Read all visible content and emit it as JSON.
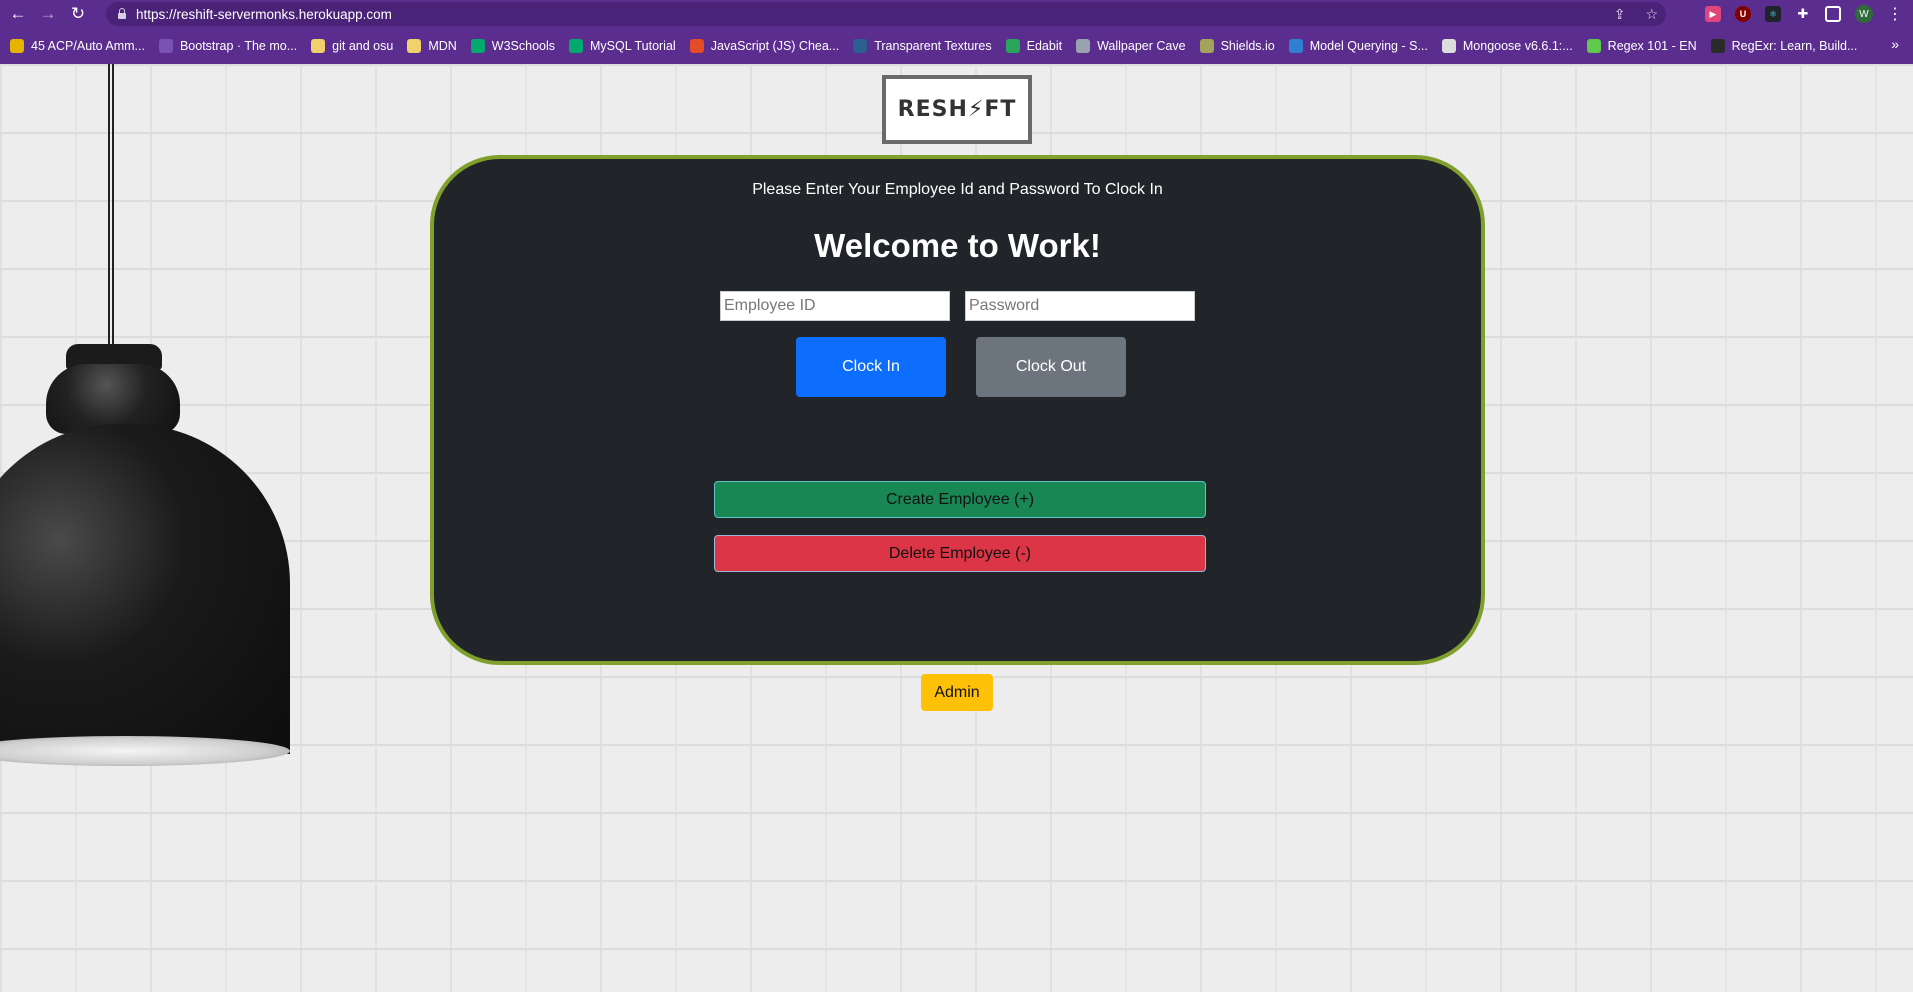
{
  "browser": {
    "url": "https://reshift-servermonks.herokuapp.com",
    "bookmarks": [
      {
        "label": "45 ACP/Auto Amm...",
        "color": "#e4b400"
      },
      {
        "label": "Bootstrap · The mo...",
        "color": "#7952b3"
      },
      {
        "label": "git and osu",
        "color": "#f2d06b"
      },
      {
        "label": "MDN",
        "color": "#f2d06b"
      },
      {
        "label": "W3Schools",
        "color": "#04aa6d"
      },
      {
        "label": "MySQL Tutorial",
        "color": "#04aa6d"
      },
      {
        "label": "JavaScript (JS) Chea...",
        "color": "#e34c26"
      },
      {
        "label": "Transparent Textures",
        "color": "#2b5f8f"
      },
      {
        "label": "Edabit",
        "color": "#29a55c"
      },
      {
        "label": "Wallpaper Cave",
        "color": "#9aa3ad"
      },
      {
        "label": "Shields.io",
        "color": "#a3a35a"
      },
      {
        "label": "Model Querying - S...",
        "color": "#2f80d1"
      },
      {
        "label": "Mongoose v6.6.1:...",
        "color": "#dddddd"
      },
      {
        "label": "Regex 101 - EN",
        "color": "#5fc94b"
      },
      {
        "label": "RegExr: Learn, Build...",
        "color": "#2a2a2a"
      }
    ],
    "profile_initial": "W"
  },
  "logo": {
    "text": "RESH⚡FT"
  },
  "panel": {
    "instruction": "Please Enter Your Employee Id and Password To Clock In",
    "heading": "Welcome to Work!",
    "employee_id_placeholder": "Employee ID",
    "password_placeholder": "Password",
    "clock_in_label": "Clock In",
    "clock_out_label": "Clock Out",
    "create_employee_label": "Create Employee (+)",
    "delete_employee_label": "Delete Employee (-)"
  },
  "admin": {
    "label": "Admin"
  },
  "colors": {
    "panel_bg": "#212529",
    "panel_border": "#7fa02c",
    "primary": "#0d6efd",
    "secondary": "#6c757d",
    "success": "#198754",
    "danger": "#dc3545",
    "warning": "#ffc107",
    "chrome": "#5b2d8e"
  }
}
